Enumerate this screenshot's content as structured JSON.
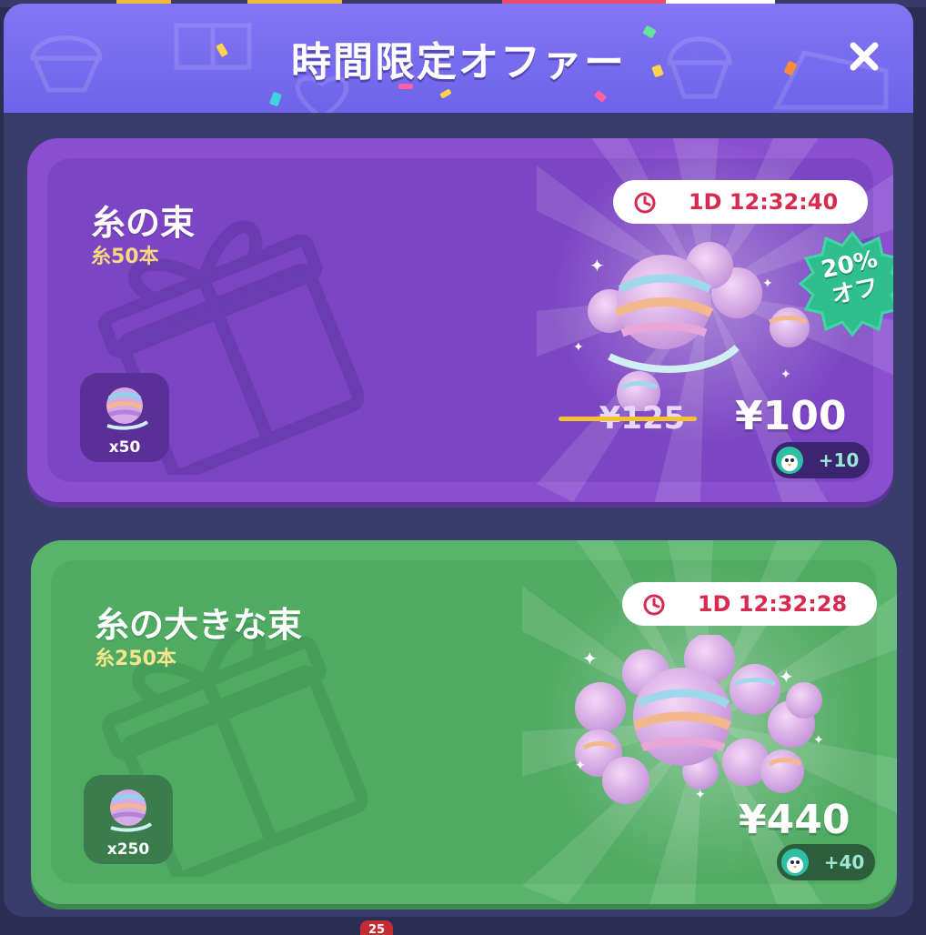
{
  "header": {
    "title": "時間限定オファー",
    "close_icon": "close-icon"
  },
  "colors": {
    "header_purple": "#7a6ef0",
    "card_purple": "#7b45c3",
    "card_green": "#4faa62",
    "timer_red": "#d8294f",
    "discount_teal": "#2fbf8f",
    "strike_yellow": "#f5c330"
  },
  "offers": [
    {
      "title": "糸の束",
      "subtitle": "糸50本",
      "item_quantity": "x50",
      "timer": "1D 12:32:40",
      "discount_label_line1": "20%",
      "discount_label_line2": "オフ",
      "original_price": "¥125",
      "price": "¥100",
      "bonus": "+10",
      "icons": [
        "clock-icon",
        "yarn-icon",
        "penguin-icon",
        "gift-icon"
      ]
    },
    {
      "title": "糸の大きな束",
      "subtitle": "糸250本",
      "item_quantity": "x250",
      "timer": "1D 12:32:28",
      "price": "¥440",
      "bonus": "+40",
      "icons": [
        "clock-icon",
        "yarn-icon",
        "penguin-icon",
        "gift-icon"
      ]
    }
  ],
  "footer": {
    "badge_number": "25"
  }
}
